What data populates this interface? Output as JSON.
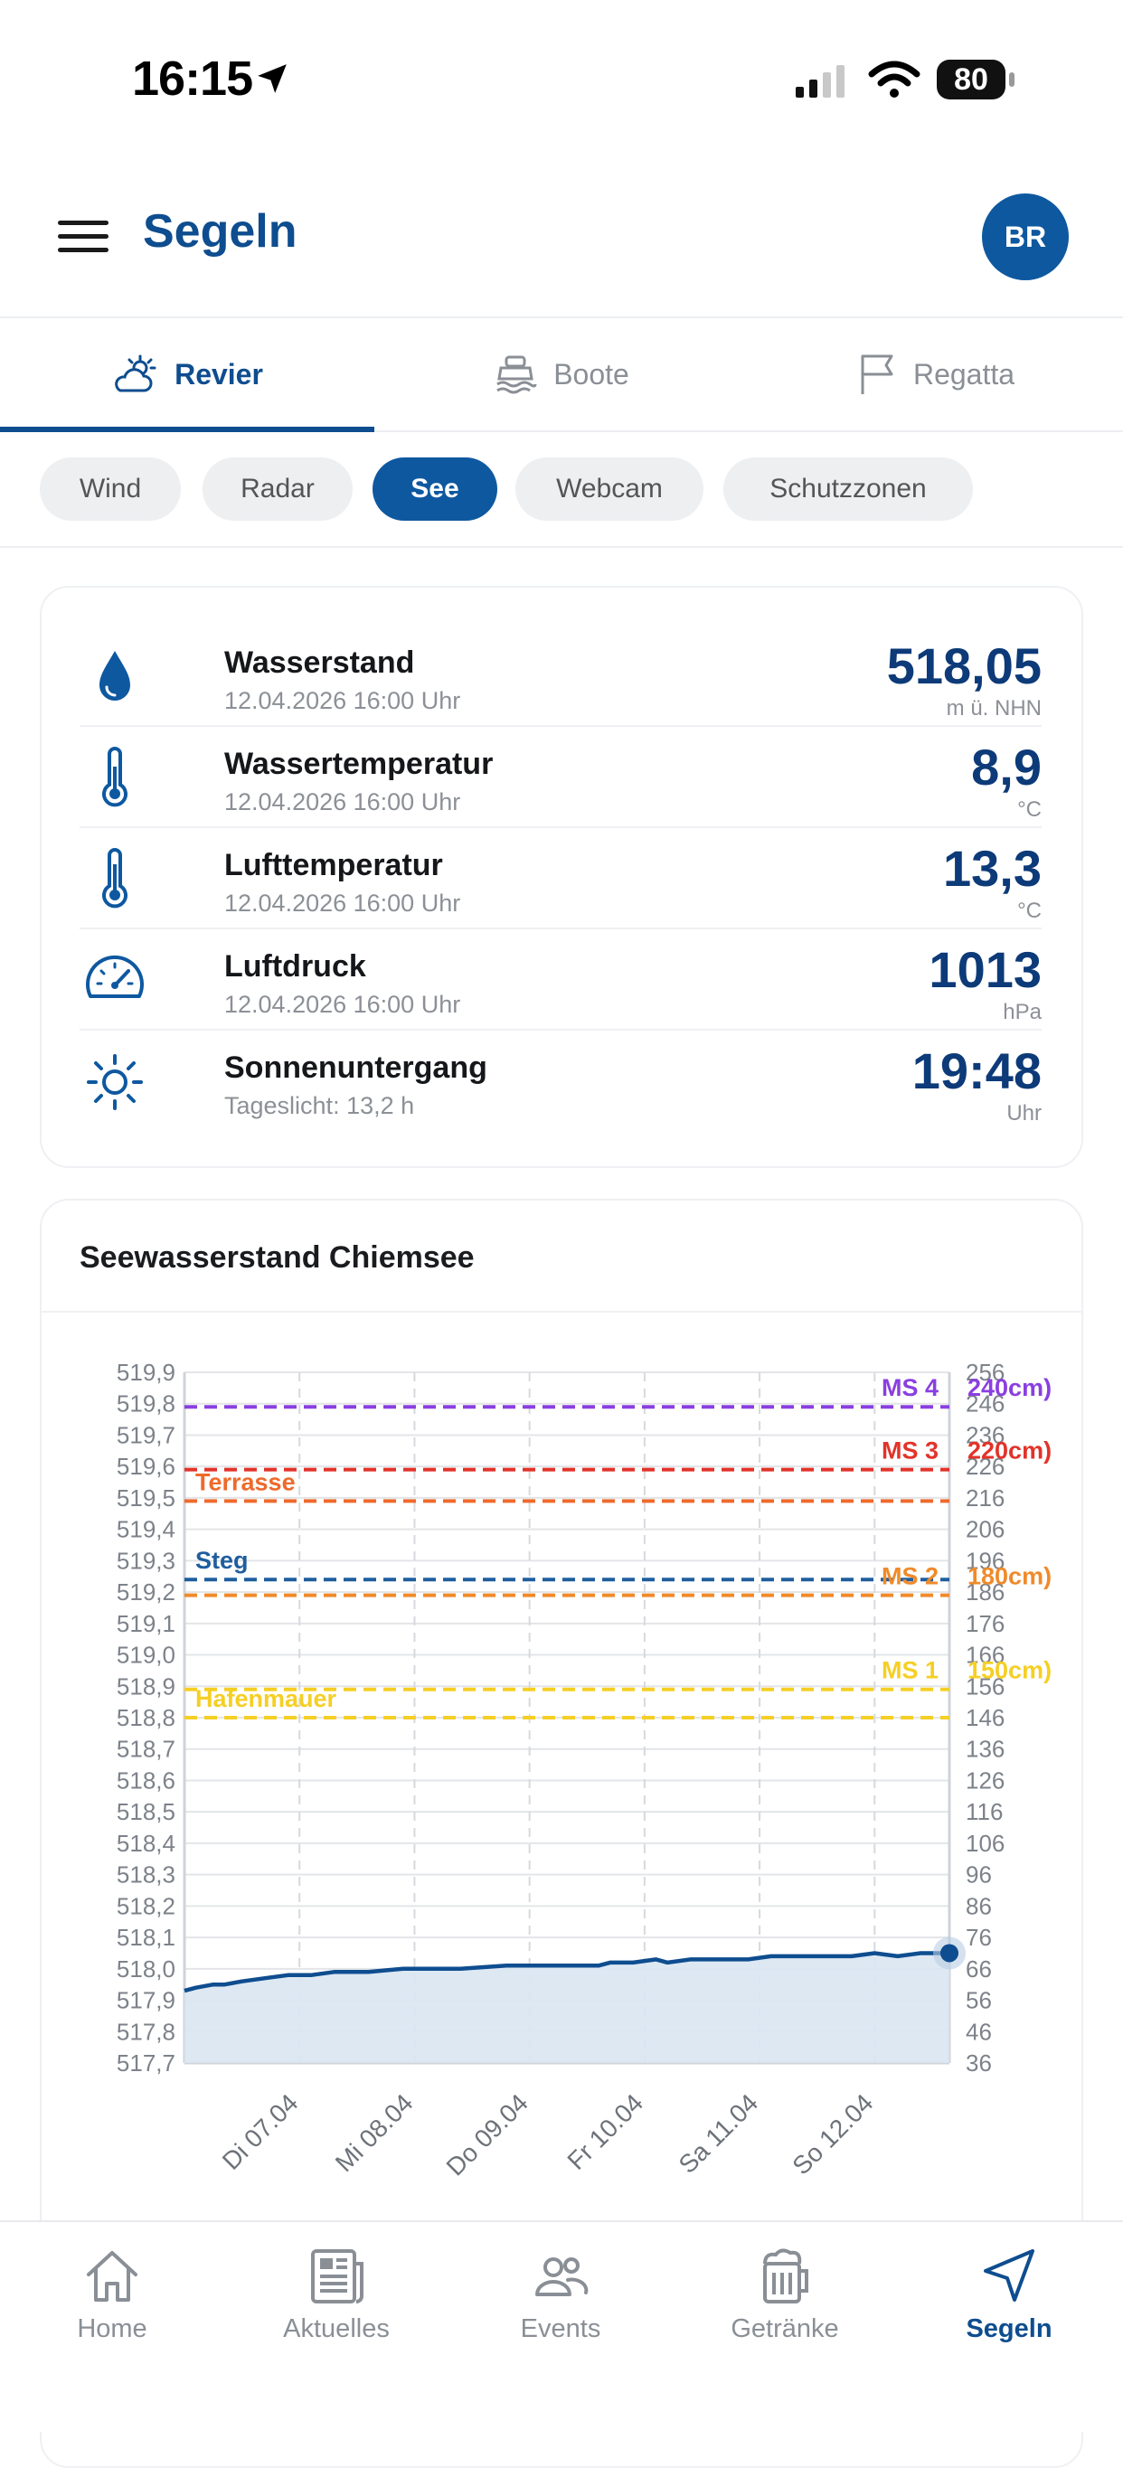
{
  "status": {
    "time": "16:15",
    "battery": "80"
  },
  "appbar": {
    "title": "Segeln",
    "avatar": "BR",
    "menu_icon": "hamburger-icon"
  },
  "tabs": [
    {
      "label": "Revier",
      "icon": "weather-cloud-sun-icon",
      "active": true
    },
    {
      "label": "Boote",
      "icon": "boat-icon",
      "active": false
    },
    {
      "label": "Regatta",
      "icon": "flag-icon",
      "active": false
    }
  ],
  "chips": [
    {
      "label": "Wind",
      "active": false
    },
    {
      "label": "Radar",
      "active": false
    },
    {
      "label": "See",
      "active": true
    },
    {
      "label": "Webcam",
      "active": false
    },
    {
      "label": "Schutzzonen",
      "active": false
    }
  ],
  "conditions": [
    {
      "label": "Wasserstand",
      "sub": "12.04.2026 16:00 Uhr",
      "value": "518,05",
      "unit": "m ü. NHN",
      "icon": "water-drop-icon"
    },
    {
      "label": "Wassertemperatur",
      "sub": "12.04.2026 16:00 Uhr",
      "value": "8,9",
      "unit": "°C",
      "icon": "thermometer-icon"
    },
    {
      "label": "Lufttemperatur",
      "sub": "12.04.2026 16:00 Uhr",
      "value": "13,3",
      "unit": "°C",
      "icon": "thermometer-icon"
    },
    {
      "label": "Luftdruck",
      "sub": "12.04.2026 16:00 Uhr",
      "value": "1013",
      "unit": "hPa",
      "icon": "gauge-icon"
    },
    {
      "label": "Sonnenuntergang",
      "sub": "Tageslicht: 13,2 h",
      "value": "19:48",
      "unit": "Uhr",
      "icon": "sun-icon"
    }
  ],
  "chart_card": {
    "title": "Seewasserstand Chiemsee"
  },
  "chart_data": {
    "type": "line",
    "title": "Seewasserstand Chiemsee",
    "y_ticks": [
      "519,9",
      "519,8",
      "519,7",
      "519,6",
      "519,5",
      "519,4",
      "519,3",
      "519,2",
      "519,1",
      "519,0",
      "518,9",
      "518,8",
      "518,7",
      "518,6",
      "518,5",
      "518,4",
      "518,3",
      "518,2",
      "518,1",
      "518,0",
      "517,9",
      "517,8",
      "517,7"
    ],
    "y2_ticks": [
      "256",
      "246",
      "236",
      "226",
      "216",
      "206",
      "196",
      "186",
      "176",
      "166",
      "156",
      "146",
      "136",
      "126",
      "116",
      "106",
      "96",
      "86",
      "76",
      "66",
      "56",
      "46",
      "36"
    ],
    "ylim": [
      517.7,
      519.9
    ],
    "x_labels": [
      "Di 07.04",
      "Mi 08.04",
      "Do 09.04",
      "Fr 10.04",
      "Sa 11.04",
      "So 12.04"
    ],
    "xlim": [
      0,
      6.65
    ],
    "series": [
      {
        "x": [
          0,
          0.1,
          0.25,
          0.35,
          0.5,
          0.7,
          0.9,
          1.1,
          1.3,
          1.6,
          1.9,
          2.0,
          2.4,
          2.8,
          3.0,
          3.3,
          3.6,
          3.7,
          3.9,
          4.1,
          4.2,
          4.4,
          4.6,
          4.9,
          5.1,
          5.2,
          5.4,
          5.6,
          5.8,
          6.0,
          6.2,
          6.4,
          6.65
        ],
        "y": [
          517.93,
          517.94,
          517.95,
          517.95,
          517.96,
          517.97,
          517.98,
          517.98,
          517.99,
          517.99,
          518.0,
          518.0,
          518.0,
          518.01,
          518.01,
          518.01,
          518.01,
          518.02,
          518.02,
          518.03,
          518.02,
          518.03,
          518.03,
          518.03,
          518.04,
          518.04,
          518.04,
          518.04,
          518.04,
          518.05,
          518.04,
          518.05,
          518.05
        ]
      }
    ],
    "reference_lines": [
      {
        "label": "MS 4",
        "side_label": "240cm)",
        "value": 519.79,
        "color": "#8a3fe0",
        "side": "right"
      },
      {
        "label": "MS 3",
        "side_label": "220cm)",
        "value": 519.59,
        "color": "#e2332a",
        "side": "right"
      },
      {
        "label": "Terrasse",
        "side_label": "",
        "value": 519.49,
        "color": "#ee6a2c",
        "side": "left"
      },
      {
        "label": "Steg",
        "side_label": "",
        "value": 519.24,
        "color": "#1f5e9e",
        "side": "left"
      },
      {
        "label": "MS 2",
        "side_label": "180cm)",
        "value": 519.19,
        "color": "#f08a2a",
        "side": "right"
      },
      {
        "label": "MS 1",
        "side_label": "150cm)",
        "value": 518.89,
        "color": "#f5cf24",
        "side": "right"
      },
      {
        "label": "Hafenmauer",
        "side_label": "",
        "value": 518.8,
        "color": "#f5cf24",
        "side": "left"
      }
    ],
    "line_color": "#0e4d8f",
    "grid": true
  },
  "nav": [
    {
      "label": "Home",
      "icon": "home-icon",
      "active": false
    },
    {
      "label": "Aktuelles",
      "icon": "newspaper-icon",
      "active": false
    },
    {
      "label": "Events",
      "icon": "people-icon",
      "active": false
    },
    {
      "label": "Getränke",
      "icon": "beer-mug-icon",
      "active": false
    },
    {
      "label": "Segeln",
      "icon": "navigation-arrow-icon",
      "active": true
    }
  ]
}
